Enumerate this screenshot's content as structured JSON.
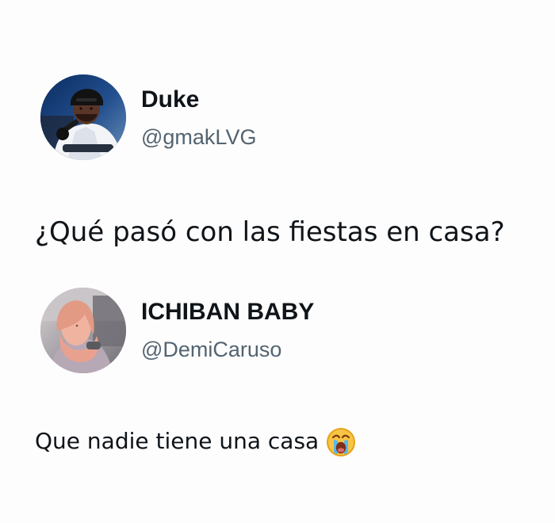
{
  "posts": [
    {
      "display_name": "Duke",
      "handle": "@gmakLVG",
      "avatar_icon": "profile-photo-man-cap",
      "text": "¿Qué pasó con las fiestas en casa?"
    },
    {
      "display_name": "ICHIBAN BABY",
      "handle": "@DemiCaruso",
      "avatar_icon": "profile-photo-woman",
      "text": "Que nadie tiene una casa",
      "emoji": "loudly-crying-face-icon"
    }
  ],
  "colors": {
    "background": "#fdfdfd",
    "name": "#0f1419",
    "handle": "#536471",
    "text": "#0f1419"
  }
}
